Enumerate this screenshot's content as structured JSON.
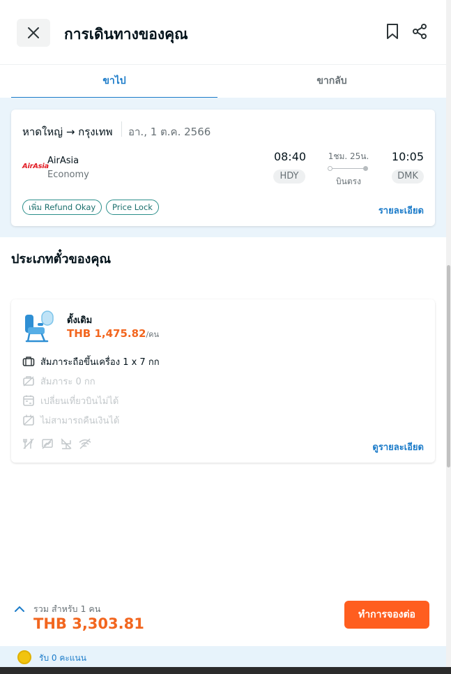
{
  "header": {
    "title": "การเดินทางของคุณ",
    "close_icon": "close-icon",
    "bookmark_icon": "bookmark-icon",
    "share_icon": "share-icon"
  },
  "tabs": [
    {
      "label": "ขาไป",
      "active": true
    },
    {
      "label": "ขากลับ",
      "active": false
    }
  ],
  "flight": {
    "route": "หาดใหญ่ → กรุงเทพ",
    "date": "อา., 1 ต.ค. 2566",
    "airline_logo_text": "AirAsia",
    "airline": "AirAsia",
    "cabin": "Economy",
    "departure_time": "08:40",
    "departure_code": "HDY",
    "duration": "1ชม. 25น.",
    "stops": "บินตรง",
    "arrival_time": "10:05",
    "arrival_code": "DMK",
    "chips": [
      "เพิ่ม Refund Okay",
      "Price Lock"
    ],
    "details_link": "รายละเอียด"
  },
  "ticket_section": {
    "title": "ประเภทตั๋วของคุณ",
    "fare_name": "ดั้งเดิม",
    "price": "THB 1,475.82",
    "price_unit": "/คน",
    "features": [
      {
        "icon": "cabin-bag-icon",
        "text": "สัมภาระถือขึ้นเครื่อง 1 x 7 กก",
        "available": true
      },
      {
        "icon": "checked-bag-off-icon",
        "text": "สัมภาระ 0 กก",
        "available": false
      },
      {
        "icon": "reschedule-off-icon",
        "text": "เปลี่ยนเที่ยวบินไม่ได้",
        "available": false
      },
      {
        "icon": "refund-off-icon",
        "text": "ไม่สามารถคืนเงินได้",
        "available": false
      }
    ],
    "amenity_icons": [
      "meal-off-icon",
      "entertainment-off-icon",
      "power-off-icon",
      "wifi-off-icon"
    ],
    "more_link": "ดูรายละเอียด"
  },
  "footer": {
    "total_label": "รวม สำหรับ 1 คน",
    "total_amount": "THB 3,303.81",
    "book_button": "ทำการจองต่อ",
    "points_text": "รับ 0 คะแนน"
  },
  "colors": {
    "accent_blue": "#1b7bc9",
    "price_orange": "#f2661f",
    "button_orange": "#ff5e1f",
    "teal_chip": "#2a8e8a"
  }
}
